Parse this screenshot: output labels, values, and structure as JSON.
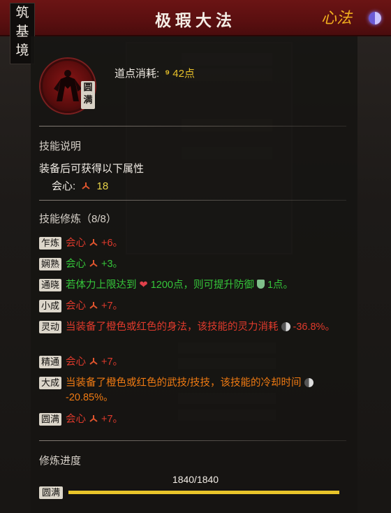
{
  "header": {
    "title": "极瑕大法",
    "xinfa": "心法"
  },
  "realm": {
    "chars": [
      "筑",
      "基",
      "境"
    ]
  },
  "skill": {
    "badge": [
      "圆",
      "满"
    ],
    "cost_label": "道点消耗:",
    "cost_value": "42点"
  },
  "desc": {
    "section_title": "技能说明",
    "line": "装备后可获得以下属性",
    "attr_name": "会心:",
    "attr_value": "18"
  },
  "training": {
    "section_title": "技能修炼（8/8）",
    "rows": [
      {
        "tag": "乍炼",
        "color": "red",
        "text": "会心",
        "value": "+6。"
      },
      {
        "tag": "娴熟",
        "color": "green",
        "text": "会心",
        "value": "+3。"
      },
      {
        "tag": "通晓",
        "color": "green",
        "pre": "若体力上限达到",
        "hp": "1200点，则可提升防御",
        "def": "1点。"
      },
      {
        "tag": "小成",
        "color": "red",
        "text": "会心",
        "value": "+7。"
      },
      {
        "tag": "灵动",
        "color": "red",
        "long": "当装备了橙色或红色的身法，该技能的灵力消耗",
        "tail": "-36.8%。"
      },
      {
        "tag": "精通",
        "color": "red",
        "text": "会心",
        "value": "+7。"
      },
      {
        "tag": "大成",
        "color": "orange",
        "long": "当装备了橙色或红色的武技/技技，该技能的冷却时间",
        "tail": "-20.85%。"
      },
      {
        "tag": "圆满",
        "color": "red",
        "text": "会心",
        "value": "+7。"
      }
    ]
  },
  "progress": {
    "title": "修炼进度",
    "value": "1840/1840",
    "current": 1840,
    "max": 1840,
    "tag": "圆满"
  },
  "colors": {
    "header": "#6b1414",
    "accent_gold": "#e8c12a",
    "red": "#e03a2c",
    "green": "#35c63a",
    "orange": "#ef7a12"
  }
}
